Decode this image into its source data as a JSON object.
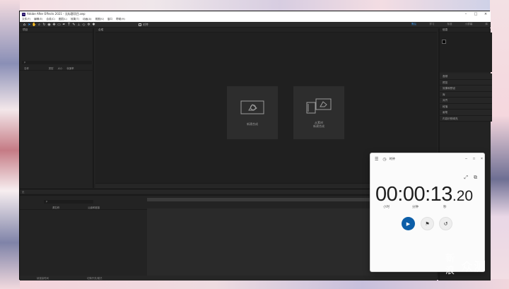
{
  "ae": {
    "title": "Adobe After Effects 2021 - 无标题项目.aep",
    "menu": [
      "文件(F)",
      "编辑(E)",
      "合成(C)",
      "图层(L)",
      "效果(T)",
      "动画(A)",
      "视图(V)",
      "窗口",
      "帮助(H)"
    ],
    "snap_label": "对齐",
    "workspaces": [
      "默认",
      "学习",
      "标准",
      "小屏幕",
      "库"
    ],
    "active_workspace": "默认",
    "project": {
      "header": "项目",
      "search_placeholder": "ρ",
      "columns": [
        "名称",
        "类型",
        "大小",
        "帧速率"
      ]
    },
    "composition": {
      "header": "合成",
      "new_comp_label": "新建合成",
      "from_footage_label_1": "从素材",
      "from_footage_label_2": "新建合成"
    },
    "right_panel": {
      "header": "信息",
      "items": [
        "音频",
        "预览",
        "效果和预设",
        "库",
        "对齐",
        "段落",
        "画笔",
        "内容识别填充"
      ]
    },
    "timeline": {
      "tab": "无",
      "search_placeholder": "ρ",
      "columns": [
        "源名称",
        "父级和链接"
      ],
      "footer": [
        "帧渲染时间",
        "切换开关/模式"
      ]
    }
  },
  "clock": {
    "title": "时钟",
    "time_main": "00:00:13",
    "time_frac": ".20",
    "units": [
      "小时",
      "分钟",
      "秒"
    ],
    "play_icon": "▶",
    "lap_icon": "⚑",
    "reset_icon": "↺"
  },
  "watermark": {
    "line1": "新",
    "line2": "浪",
    "text": "众测"
  },
  "colors": {
    "accent": "#0c5ea8",
    "workspace_active": "#3a9bf2"
  }
}
